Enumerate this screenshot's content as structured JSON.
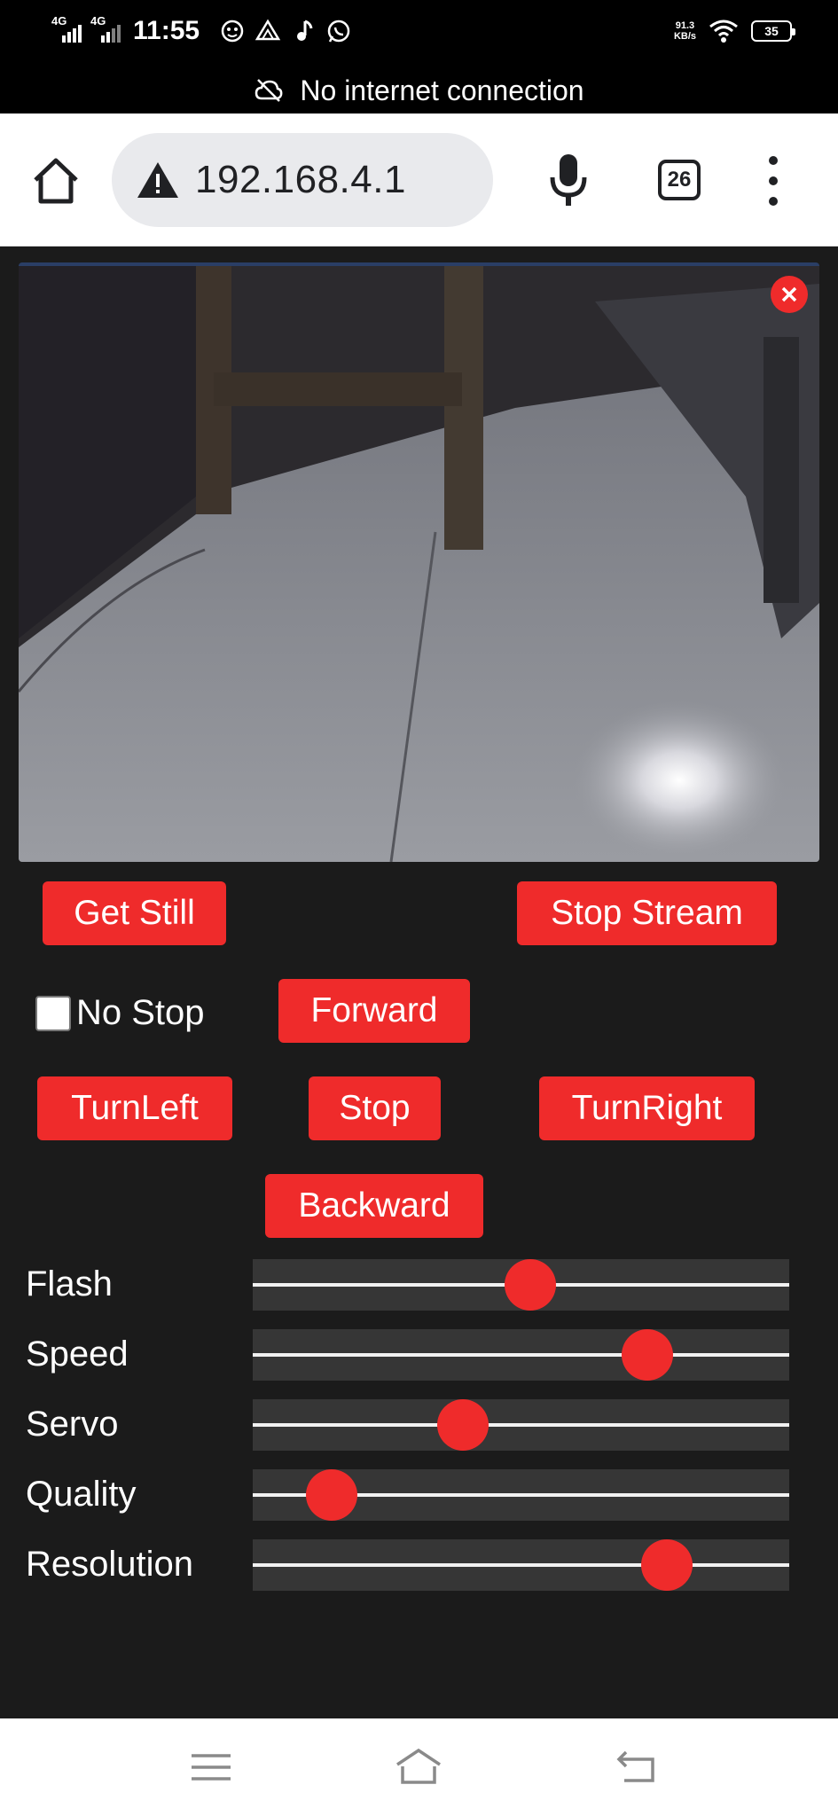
{
  "status_bar": {
    "sig1": "4G",
    "sig2": "4G",
    "time": "11:55",
    "net_speed_value": "91.3",
    "net_speed_unit": "KB/s",
    "battery": "35",
    "icons": [
      "face-notification-icon",
      "drive-icon",
      "music-icon",
      "whatsapp-icon",
      "wifi-icon"
    ]
  },
  "connection_banner": {
    "text": "No internet connection",
    "icon": "cloud-off-icon"
  },
  "browser": {
    "url": "192.168.4.1",
    "tab_count": "26",
    "icons": [
      "home-icon",
      "warning-icon",
      "mic-icon",
      "menu-icon"
    ]
  },
  "camera": {
    "close_icon": "close-icon"
  },
  "buttons": {
    "get_still": "Get Still",
    "stop_stream": "Stop Stream",
    "forward": "Forward",
    "turn_left": "TurnLeft",
    "stop": "Stop",
    "turn_right": "TurnRight",
    "backward": "Backward"
  },
  "no_stop": {
    "label": "No Stop",
    "checked": false
  },
  "sliders": [
    {
      "label": "Flash",
      "level": 0.52
    },
    {
      "label": "Speed",
      "level": 0.76
    },
    {
      "label": "Servo",
      "level": 0.38
    },
    {
      "label": "Quality",
      "level": 0.11
    },
    {
      "label": "Resolution",
      "level": 0.8
    }
  ],
  "colors": {
    "accent": "#ef2b2b",
    "background": "#1b1b1b",
    "track": "#363636"
  },
  "nav_bar": {
    "icons": [
      "recents-menu-icon",
      "home-nav-icon",
      "back-icon"
    ]
  }
}
